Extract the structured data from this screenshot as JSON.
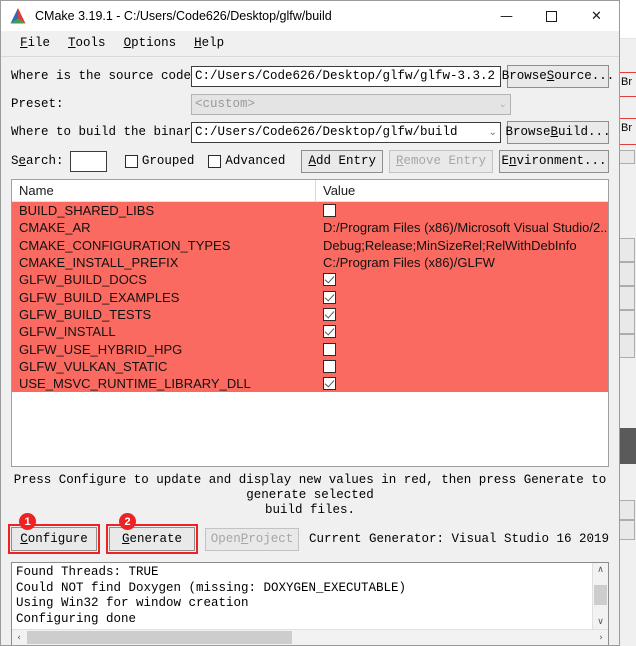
{
  "window": {
    "title": "CMake 3.19.1 - C:/Users/Code626/Desktop/glfw/build",
    "app_icon": "cmake-logo-icon",
    "minimize_label": "—",
    "maximize_label": "☐",
    "close_label": "✕"
  },
  "menubar": {
    "items": [
      {
        "label": "File",
        "mnemonic": "F",
        "rest": "ile"
      },
      {
        "label": "Tools",
        "mnemonic": "T",
        "rest": "ools"
      },
      {
        "label": "Options",
        "mnemonic": "O",
        "rest": "ptions"
      },
      {
        "label": "Help",
        "mnemonic": "H",
        "rest": "elp"
      }
    ]
  },
  "form": {
    "source_label_pre": "",
    "source_label": "Where is the source code:",
    "source_value": "C:/Users/Code626/Desktop/glfw/glfw-3.3.2",
    "browse_source_mnemonic": "S",
    "browse_source_pre": "Browse ",
    "browse_source_post": "ource...",
    "preset_label": "Preset:",
    "preset_value": "<custom>",
    "build_label": "Where to build the binaries:",
    "build_value": "C:/Users/Code626/Desktop/glfw/build",
    "browse_build_mnemonic": "B",
    "browse_build_pre": "Browse ",
    "browse_build_post": "uild...",
    "chevron": "⌄"
  },
  "search": {
    "label_mnemonic": "e",
    "label_pre": "S",
    "label_post": "arch:",
    "value": "",
    "placeholder": "",
    "grouped_label": "Grouped",
    "grouped_checked": false,
    "advanced_label": "Advanced",
    "advanced_checked": false,
    "add_entry_label_pre": "",
    "add_entry_mnemonic": "A",
    "add_entry_post": "dd Entry",
    "remove_entry_mnemonic": "R",
    "remove_entry_post": "emove Entry",
    "remove_entry_disabled": true,
    "environment_pre": "E",
    "environment_mnemonic": "n",
    "environment_post": "vironment..."
  },
  "cache_table": {
    "columns": [
      "Name",
      "Value"
    ],
    "highlight_color": "#fb6a60",
    "rows": [
      {
        "name": "BUILD_SHARED_LIBS",
        "type": "checkbox",
        "checked": false,
        "value": ""
      },
      {
        "name": "CMAKE_AR",
        "type": "text",
        "checked": null,
        "value": "D:/Program Files (x86)/Microsoft Visual Studio/2..."
      },
      {
        "name": "CMAKE_CONFIGURATION_TYPES",
        "type": "text",
        "checked": null,
        "value": "Debug;Release;MinSizeRel;RelWithDebInfo"
      },
      {
        "name": "CMAKE_INSTALL_PREFIX",
        "type": "text",
        "checked": null,
        "value": "C:/Program Files (x86)/GLFW"
      },
      {
        "name": "GLFW_BUILD_DOCS",
        "type": "checkbox",
        "checked": true,
        "value": ""
      },
      {
        "name": "GLFW_BUILD_EXAMPLES",
        "type": "checkbox",
        "checked": true,
        "value": ""
      },
      {
        "name": "GLFW_BUILD_TESTS",
        "type": "checkbox",
        "checked": true,
        "value": ""
      },
      {
        "name": "GLFW_INSTALL",
        "type": "checkbox",
        "checked": true,
        "value": ""
      },
      {
        "name": "GLFW_USE_HYBRID_HPG",
        "type": "checkbox",
        "checked": false,
        "value": ""
      },
      {
        "name": "GLFW_VULKAN_STATIC",
        "type": "checkbox",
        "checked": false,
        "value": ""
      },
      {
        "name": "USE_MSVC_RUNTIME_LIBRARY_DLL",
        "type": "checkbox",
        "checked": true,
        "value": ""
      }
    ]
  },
  "hint": {
    "line1": "Press Configure to update and display new values in red, then press Generate to generate selected",
    "line2": "build files."
  },
  "actions": {
    "configure_pre": "",
    "configure_mnemonic": "C",
    "configure_post": "onfigure",
    "generate_mnemonic": "G",
    "generate_post": "enerate",
    "open_project_pre": "Open ",
    "open_project_mnemonic": "P",
    "open_project_post": "roject",
    "open_project_disabled": true,
    "generator_text": "Current Generator: Visual Studio 16 2019",
    "generator_field_value": "",
    "badge_1": "1",
    "badge_2": "2",
    "annotation_color": "#ee2222"
  },
  "log": {
    "lines": [
      "Found Threads: TRUE",
      "Could NOT find Doxygen (missing: DOXYGEN_EXECUTABLE)",
      "Using Win32 for window creation",
      "Configuring done"
    ],
    "scroll_up": "∧",
    "scroll_down": "∨",
    "scroll_left": "‹",
    "scroll_right": "›"
  },
  "background_window": {
    "label_1": "Br",
    "label_2": "Br"
  }
}
